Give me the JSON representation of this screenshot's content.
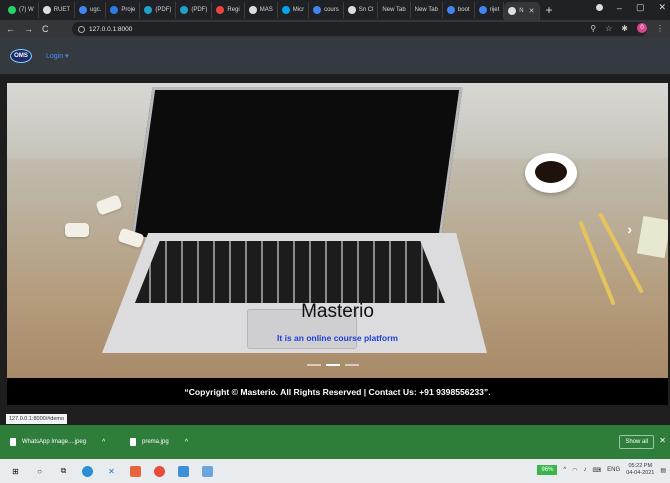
{
  "browser": {
    "tabs": [
      {
        "label": "(7) W",
        "color": "#25d366"
      },
      {
        "label": "RUET",
        "color": "#dddddd"
      },
      {
        "label": "ugc.",
        "color": "#4285f4"
      },
      {
        "label": "Proje",
        "color": "#2d7be5"
      },
      {
        "label": "(PDF)",
        "color": "#21a0c9"
      },
      {
        "label": "(PDF)",
        "color": "#21a0c9"
      },
      {
        "label": "Regi",
        "color": "#e8453c"
      },
      {
        "label": "MAS",
        "color": "#dddddd"
      },
      {
        "label": "Micr",
        "color": "#00a4ef"
      },
      {
        "label": "cours",
        "color": "#4285f4"
      },
      {
        "label": "Sn Cl",
        "color": "#dddddd"
      },
      {
        "label": "New Tab",
        "color": ""
      },
      {
        "label": "New Tab",
        "color": ""
      },
      {
        "label": "boot",
        "color": "#4285f4"
      },
      {
        "label": "rijet",
        "color": "#4285f4"
      },
      {
        "label": "N",
        "color": "#dddddd"
      }
    ],
    "new_tab_symbol": "+",
    "url": "127.0.0.1:8000",
    "status_url": "127.0.0.1:8000/#demo",
    "profile_initial": "0"
  },
  "site": {
    "logo_text": "OMS",
    "login_label": "Login ▾",
    "hero_title": "Masterio",
    "hero_subtitle": "It is an online course platform",
    "carousel_next": "›",
    "footer_text": "“Copyright © Masterio. All Rights Reserved | Contact Us: +91 9398556233”."
  },
  "downloads": {
    "items": [
      {
        "name": "WhatsApp Image....jpeg"
      },
      {
        "name": "prema.jpg"
      }
    ],
    "show_all": "Show all",
    "close": "✕"
  },
  "taskbar": {
    "battery": "96%",
    "lang": "ENG",
    "time": "05:22 PM",
    "date": "04-04-2021"
  }
}
